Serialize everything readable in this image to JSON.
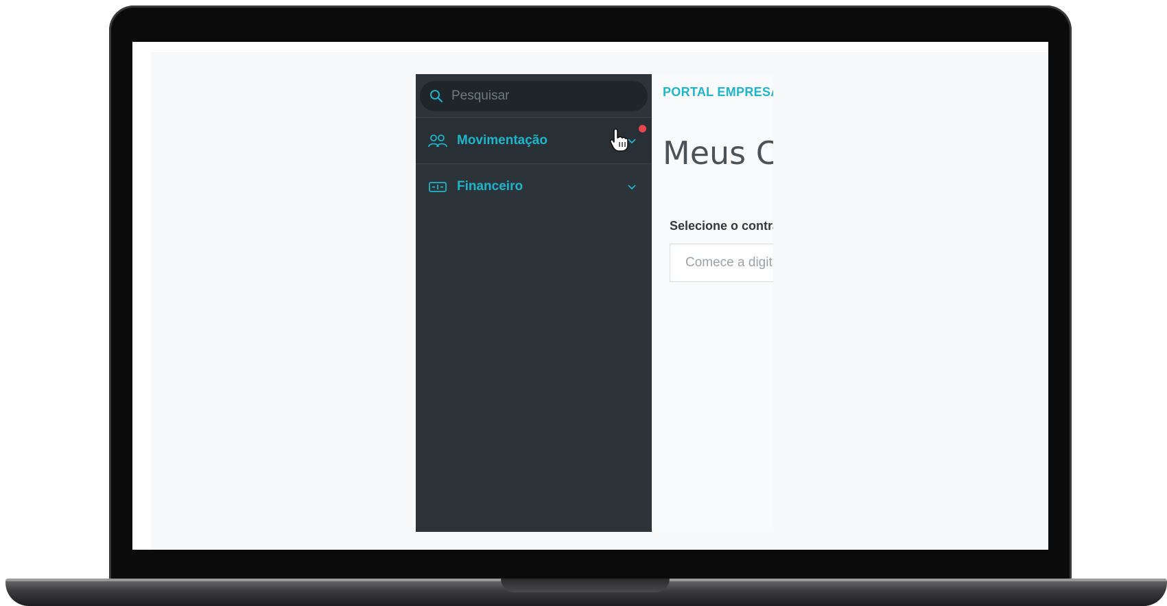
{
  "sidebar": {
    "search": {
      "placeholder": "Pesquisar",
      "icon": "search-icon"
    },
    "items": [
      {
        "label": "Movimentação",
        "icon": "users-icon",
        "has_notification": true
      },
      {
        "label": "Financeiro",
        "icon": "money-icon",
        "expandable": true
      }
    ]
  },
  "main": {
    "breadcrumb": "PORTAL EMPRESA",
    "title": "Meus Contratos",
    "field_label": "Selecione o contrato",
    "field_placeholder": "Comece a digitar"
  },
  "colors": {
    "sidebar_bg": "#2c3439",
    "accent": "#1eb5cc",
    "notification": "#e8444d",
    "content_bg": "#f9fafb"
  }
}
